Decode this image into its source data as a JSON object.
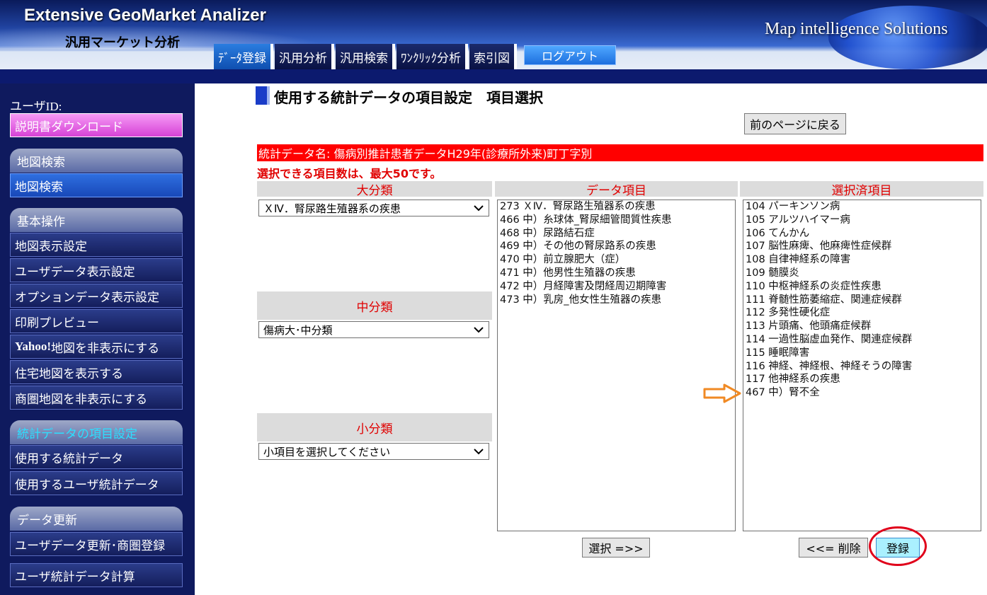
{
  "header": {
    "app_title": "Extensive GeoMarket Analizer",
    "app_subtitle": "汎用マーケット分析",
    "brand": "Map intelligence Solutions",
    "tabs": [
      {
        "label": "ﾃﾞｰﾀ登録",
        "active": true
      },
      {
        "label": "汎用分析",
        "active": false
      },
      {
        "label": "汎用検索",
        "active": false
      },
      {
        "label": "ﾜﾝｸﾘｯｸ分析",
        "active": false
      },
      {
        "label": "索引図",
        "active": false
      }
    ],
    "logout_label": "ログアウト"
  },
  "sidebar": {
    "user_id_label": "ユーザID:",
    "download_label": "説明書ダウンロード",
    "sections": [
      {
        "heading": "地図検索",
        "items": [
          "地図検索"
        ]
      },
      {
        "heading": "基本操作",
        "items": [
          "地図表示設定",
          "ユーザデータ表示設定",
          "オプションデータ表示設定",
          "印刷プレビュー",
          "Yahoo!地図を非表示にする",
          "住宅地図を表示する",
          "商圏地図を非表示にする"
        ]
      },
      {
        "heading": "統計データの項目設定",
        "items": [
          "使用する統計データ",
          "使用するユーザ統計データ"
        ]
      },
      {
        "heading": "データ更新",
        "items": [
          "ユーザデータ更新･商圏登録",
          "ユーザ統計データ計算"
        ]
      }
    ],
    "yahoo_bold": "Yahoo!",
    "yahoo_rest": "地図を非表示にする"
  },
  "main": {
    "page_title": "使用する統計データの項目設定　項目選択",
    "back_label": "前のページに戻る",
    "dataset_label": "統計データ名: 傷病別推計患者データH29年(診療所外来)町丁字別",
    "limit_note": "選択できる項目数は、最大50です。",
    "headers": {
      "major": "大分類",
      "middle": "中分類",
      "minor": "小分類",
      "data_items": "データ項目",
      "selected_items": "選択済項目"
    },
    "major_value": "ＸⅣ．腎尿路生殖器系の疾患",
    "middle_value": "傷病大･中分類",
    "minor_value": "小項目を選択してください",
    "data_items": [
      "273 ＸⅣ．腎尿路生殖器系の疾患",
      "466 中）糸球体_腎尿細管間質性疾患",
      "468 中）尿路結石症",
      "469 中）その他の腎尿路系の疾患",
      "470 中）前立腺肥大（症）",
      "471 中）他男性生殖器の疾患",
      "472 中）月経障害及閉経周辺期障害",
      "473 中）乳房_他女性生殖器の疾患"
    ],
    "selected_items": [
      "104 パーキンソン病",
      "105 アルツハイマー病",
      "106 てんかん",
      "107 脳性麻痺、他麻痺性症候群",
      "108 自律神経系の障害",
      "109 髄膜炎",
      "110 中枢神経系の炎症性疾患",
      "111 脊髄性筋萎縮症、関連症候群",
      "112 多発性硬化症",
      "113 片頭痛、他頭痛症候群",
      "114 一過性脳虚血発作、関連症候群",
      "115 睡眠障害",
      "116 神経、神経根、神経そうの障害",
      "117 他神経系の疾患",
      "467 中）腎不全"
    ],
    "select_btn": "選択 =>>",
    "delete_btn": "<<= 削除",
    "register_btn": "登録",
    "colors": {
      "alert": "#ff0000",
      "arrow": "#f08a24",
      "highlight_circle": "#e0001a"
    }
  }
}
